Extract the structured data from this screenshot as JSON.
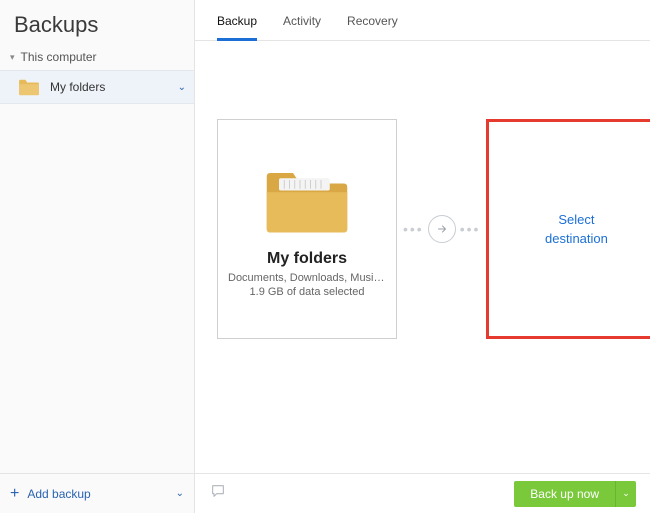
{
  "sidebar": {
    "title": "Backups",
    "computer_label": "This computer",
    "item": {
      "label": "My folders"
    },
    "add_label": "Add backup"
  },
  "tabs": {
    "backup": "Backup",
    "activity": "Activity",
    "recovery": "Recovery"
  },
  "source": {
    "name": "My folders",
    "desc": "Documents, Downloads, Music, Pi…",
    "size": "1.9 GB of data selected"
  },
  "destination": {
    "line1": "Select",
    "line2": "destination"
  },
  "footer": {
    "backup_now": "Back up now"
  }
}
